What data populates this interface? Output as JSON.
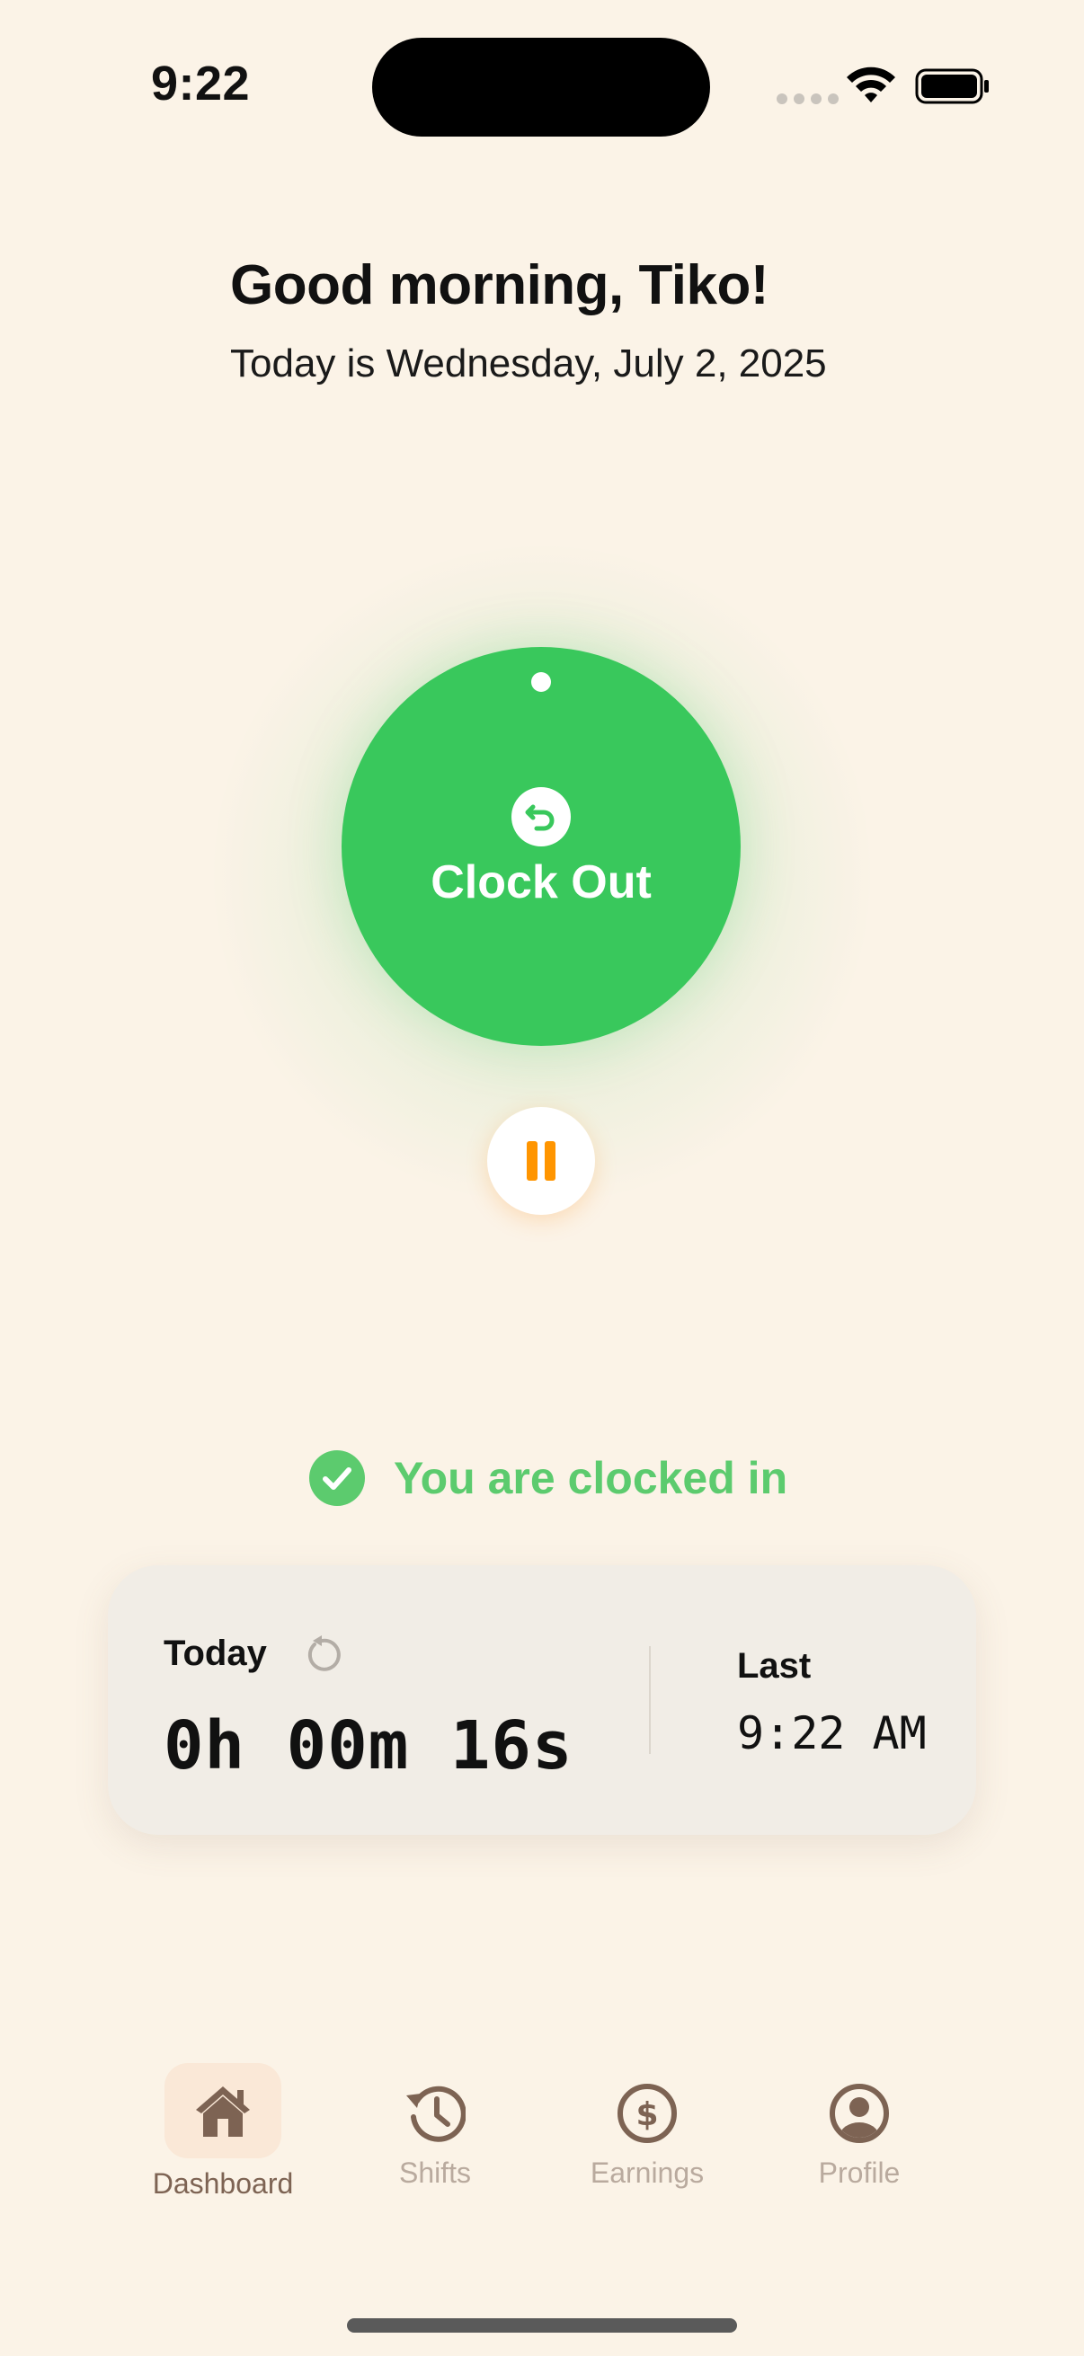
{
  "status_bar": {
    "time": "9:22"
  },
  "header": {
    "greeting": "Good morning, Tiko!",
    "date_line": "Today is Wednesday, July 2, 2025"
  },
  "clock": {
    "button_label": "Clock Out",
    "button_color": "#39C85C"
  },
  "status": {
    "text": "You are clocked in",
    "color": "#5CCB6E"
  },
  "timer_card": {
    "today_label": "Today",
    "timer_value": "0h 00m 16s",
    "last_label": "Last",
    "last_time": "9:22 AM"
  },
  "tabs": [
    {
      "label": "Dashboard",
      "icon": "house-icon",
      "active": true
    },
    {
      "label": "Shifts",
      "icon": "history-clock-icon",
      "active": false
    },
    {
      "label": "Earnings",
      "icon": "dollar-circle-icon",
      "active": false
    },
    {
      "label": "Profile",
      "icon": "person-circle-icon",
      "active": false
    }
  ],
  "colors": {
    "background": "#FBF3E7",
    "accent_orange": "#FF9500",
    "tab_active": "#7D6353",
    "tab_inactive": "#B9AA9E"
  }
}
